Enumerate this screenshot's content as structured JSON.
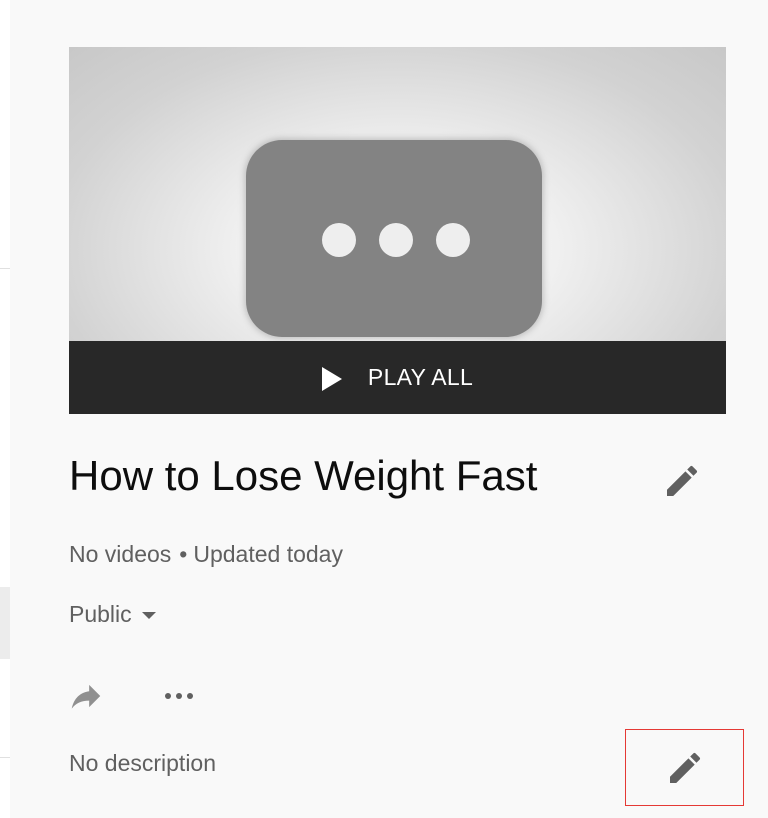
{
  "thumbnail": {
    "play_all_label": "PLAY ALL"
  },
  "playlist": {
    "title": "How to Lose Weight Fast",
    "video_count": "No videos",
    "separator": "•",
    "updated": "Updated today",
    "privacy": "Public",
    "description": "No description"
  },
  "icons": {
    "edit_title": "pencil-icon",
    "edit_description": "pencil-icon",
    "share": "share-arrow-icon",
    "more": "more-horizontal-icon",
    "play": "play-icon",
    "privacy_dropdown": "caret-down-icon"
  },
  "colors": {
    "play_bar": "#282828",
    "title_text": "#0d0d0d",
    "secondary_text": "#606060",
    "highlight_border": "#e53935"
  }
}
